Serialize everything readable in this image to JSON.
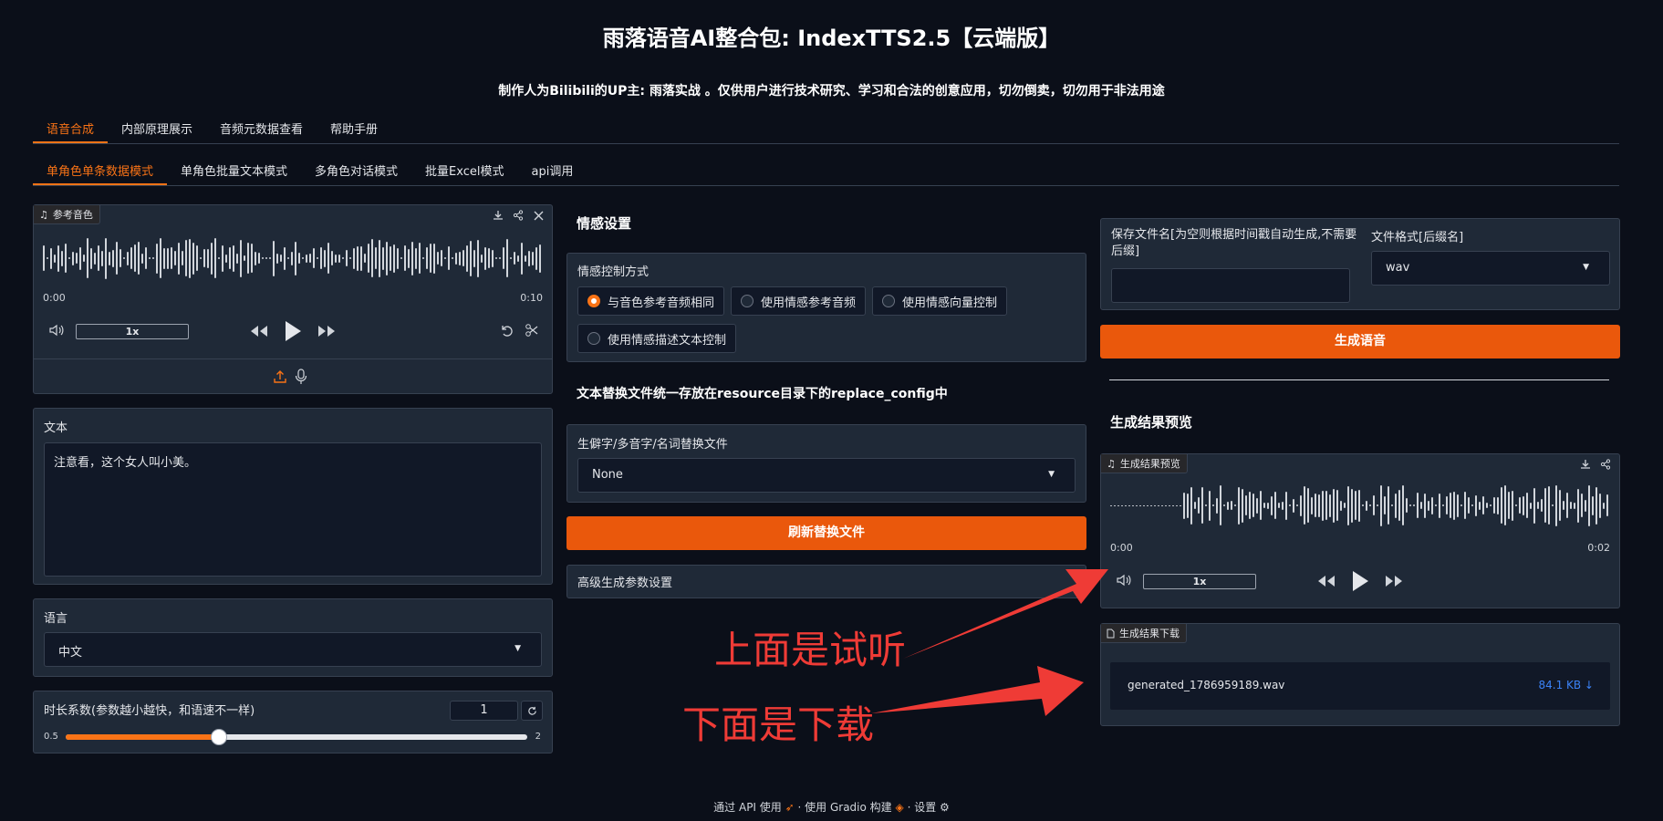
{
  "header": {
    "title": "雨落语音AI整合包: IndexTTS2.5【云端版】",
    "subtitle": "制作人为Bilibili的UP主: 雨落实战 。仅供用户进行技术研究、学习和合法的创意应用，切勿倒卖，切勿用于非法用途"
  },
  "main_tabs": [
    "语音合成",
    "内部原理展示",
    "音频元数据查看",
    "帮助手册"
  ],
  "sub_tabs": [
    "单角色单条数据模式",
    "单角色批量文本模式",
    "多角色对话模式",
    "批量Excel模式",
    "api调用"
  ],
  "ref_audio": {
    "label": "参考音色",
    "time_start": "0:00",
    "time_end": "0:10",
    "speed": "1x"
  },
  "text_input": {
    "label": "文本",
    "value": "注意看，这个女人叫小美。"
  },
  "language": {
    "label": "语言",
    "value": "中文"
  },
  "duration": {
    "label": "时长系数(参数越小越快，和语速不一样)",
    "value": "1",
    "min": "0.5",
    "max": "2",
    "slider_fraction": 0.333
  },
  "emotion": {
    "heading": "情感设置",
    "mode_label": "情感控制方式",
    "options": [
      "与音色参考音频相同",
      "使用情感参考音频",
      "使用情感向量控制",
      "使用情感描述文本控制"
    ],
    "selected_index": 0
  },
  "replace": {
    "heading": "文本替换文件统一存放在resource目录下的replace_config中",
    "file_label": "生僻字/多音字/名词替换文件",
    "file_value": "None",
    "refresh_button": "刷新替换文件",
    "advanced_label": "高级生成参数设置"
  },
  "output": {
    "filename_label": "保存文件名[为空则根据时间戳自动生成,不需要后缀]",
    "filename_value": "",
    "format_label": "文件格式[后缀名]",
    "format_value": "wav",
    "generate_button": "生成语音",
    "preview_heading": "生成结果预览",
    "preview_chip": "生成结果预览",
    "preview_time_start": "0:00",
    "preview_time_end": "0:02",
    "preview_speed": "1x",
    "download_chip": "生成结果下载",
    "download_file": "generated_1786959189.wav",
    "download_size": "84.1 KB ↓"
  },
  "annotations": {
    "top": "上面是试听",
    "bottom": "下面是下载",
    "color": "#ef3b36"
  },
  "footer": {
    "api": "通过 API 使用",
    "gradio": "使用 Gradio 构建",
    "settings": "设置"
  },
  "colors": {
    "accent": "#f97316",
    "button": "#ea580c",
    "background": "#0b0f19",
    "panel": "#1f2937"
  }
}
